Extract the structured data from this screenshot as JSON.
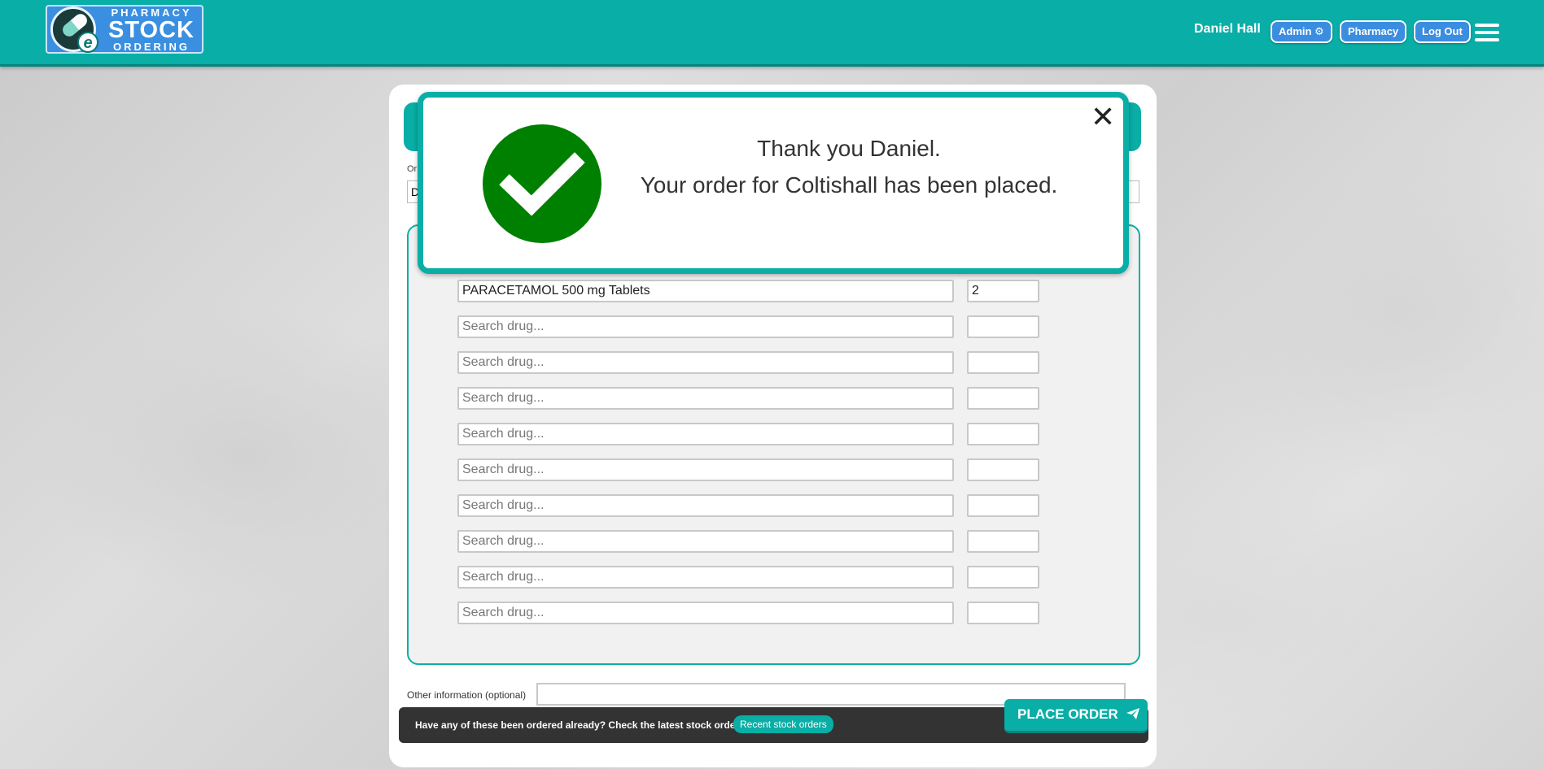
{
  "header": {
    "logo_line1": "PHARMACY",
    "logo_line2": "STOCK",
    "logo_line3": "ORDERING",
    "logo_e": "e",
    "user_name": "Daniel Hall",
    "admin_label": "Admin ⚙",
    "pharmacy_label": "Pharmacy",
    "logout_label": "Log Out"
  },
  "modal": {
    "line1": "Thank you Daniel.",
    "line2": "Your order for Coltishall has been placed.",
    "close": "✕"
  },
  "order": {
    "hidden_label": "Or",
    "hidden_value": "D",
    "rows": [
      {
        "drug": "PARACETAMOL 500 mg Tablets",
        "qty": "2"
      },
      {
        "drug": "",
        "qty": ""
      },
      {
        "drug": "",
        "qty": ""
      },
      {
        "drug": "",
        "qty": ""
      },
      {
        "drug": "",
        "qty": ""
      },
      {
        "drug": "",
        "qty": ""
      },
      {
        "drug": "",
        "qty": ""
      },
      {
        "drug": "",
        "qty": ""
      },
      {
        "drug": "",
        "qty": ""
      },
      {
        "drug": "",
        "qty": ""
      }
    ],
    "search_placeholder": "Search drug...",
    "other_label": "Other information (optional)",
    "other_value": ""
  },
  "footer": {
    "prompt": "Have any of these been ordered already? Check the latest stock orders.",
    "recent_button": "Recent stock orders",
    "place_order": "PLACE ORDER"
  },
  "colors": {
    "teal": "#09aea6",
    "success_green": "#008000",
    "header_button": "#3b8de0",
    "bottom_bar": "#333333"
  }
}
